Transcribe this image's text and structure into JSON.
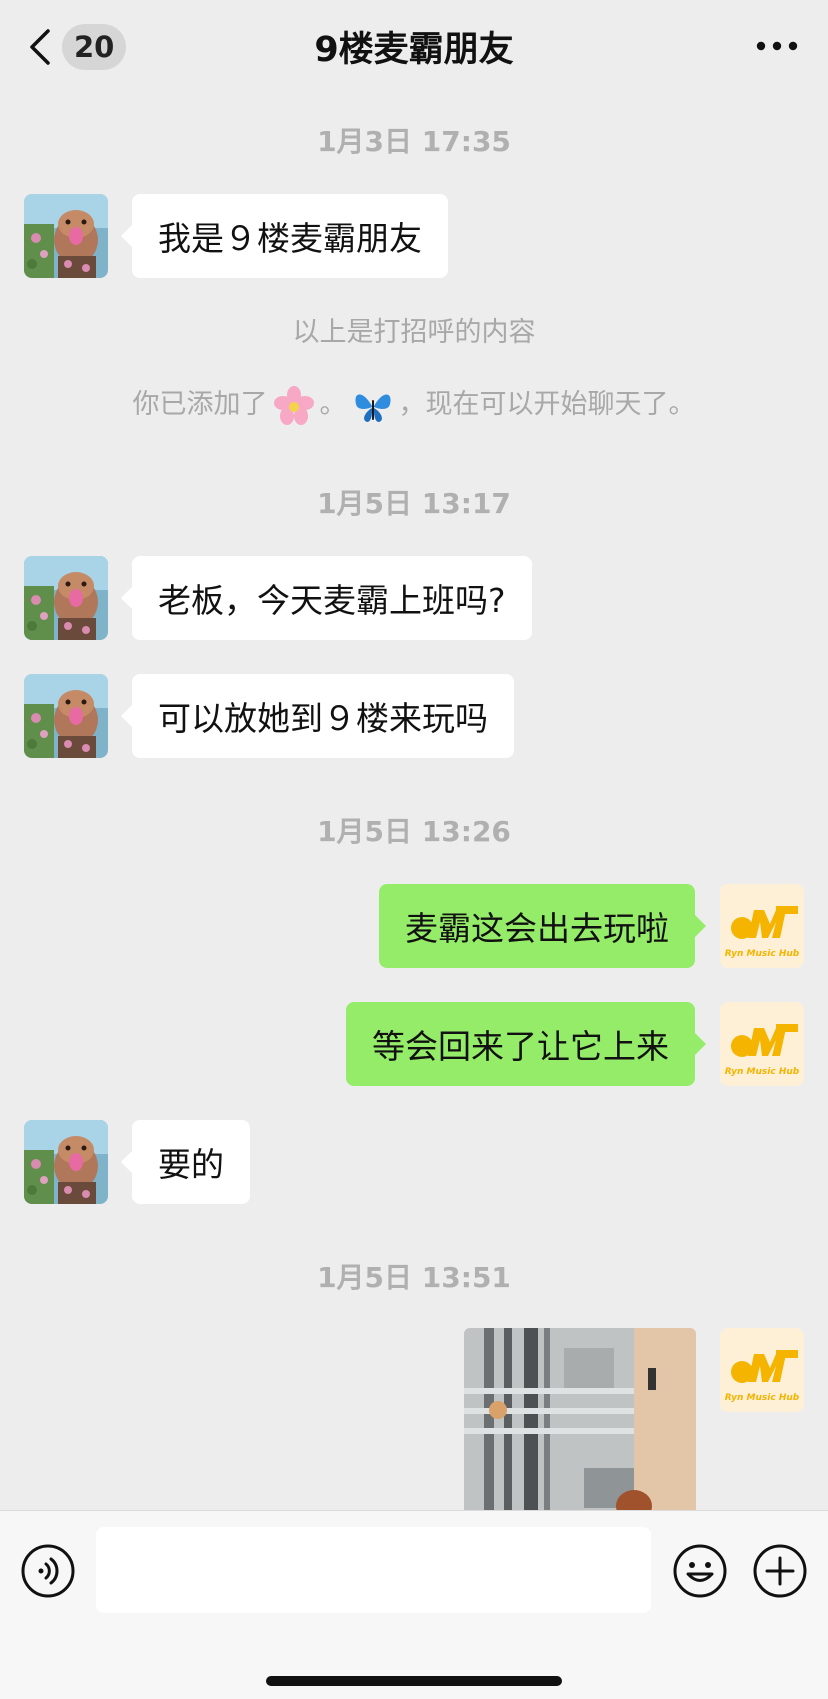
{
  "header": {
    "back_label": "",
    "unread_count": "20",
    "title": "9楼麦霸朋友"
  },
  "messages": [
    {
      "kind": "time",
      "text": "1月3日 17:35"
    },
    {
      "kind": "in",
      "text": "我是９楼麦霸朋友"
    },
    {
      "kind": "system",
      "text": "以上是打招呼的内容"
    },
    {
      "kind": "system",
      "text_before": "你已添加了",
      "emoji_1": "cherry-blossom-icon",
      "middle": "。",
      "emoji_2": "butterfly-icon",
      "text_after": "，现在可以开始聊天了。"
    },
    {
      "kind": "time",
      "text": "1月5日 13:17"
    },
    {
      "kind": "in",
      "text": "老板，今天麦霸上班吗?"
    },
    {
      "kind": "in",
      "text": "可以放她到９楼来玩吗"
    },
    {
      "kind": "time",
      "text": "1月5日 13:26"
    },
    {
      "kind": "out",
      "text": "麦霸这会出去玩啦"
    },
    {
      "kind": "out",
      "text": "等会回来了让它上来"
    },
    {
      "kind": "in",
      "text": "要的"
    },
    {
      "kind": "time",
      "text": "1月5日 13:51"
    },
    {
      "kind": "out-image",
      "text": ""
    }
  ],
  "self_avatar": {
    "logo_text": "Ryn Music Hub"
  },
  "footer": {
    "input_value": ""
  },
  "colors": {
    "background": "#ededed",
    "incoming_bubble": "#ffffff",
    "outgoing_bubble": "#95ec69",
    "timestamp": "#b0b0b0"
  }
}
